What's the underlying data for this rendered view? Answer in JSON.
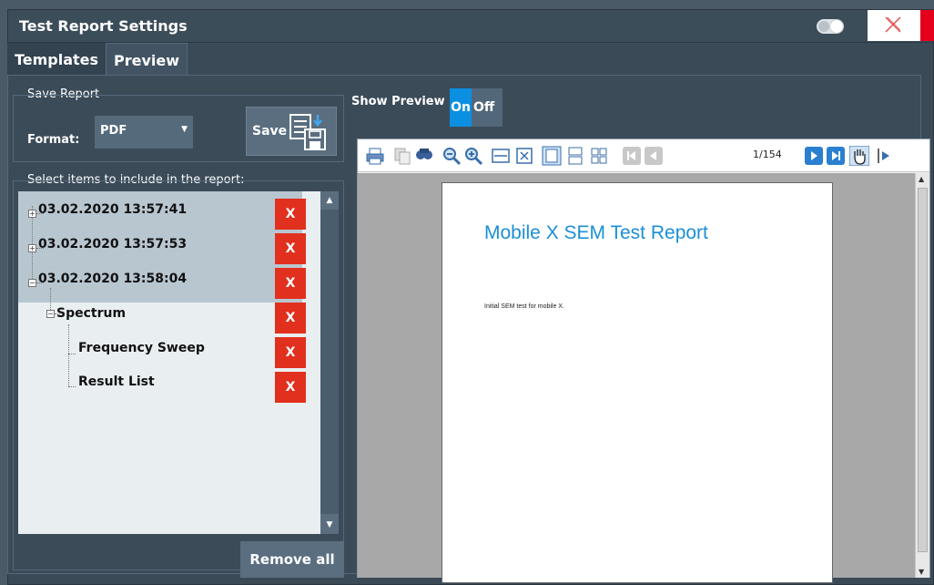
{
  "window": {
    "title": "Test Report Settings"
  },
  "tabs": [
    {
      "label": "Templates"
    },
    {
      "label": "Preview"
    }
  ],
  "save_report": {
    "group_label": "Save Report",
    "format_label": "Format:",
    "format_value": "PDF",
    "save_label": "Save"
  },
  "items": {
    "label": "Select items to include in the report:",
    "tree": [
      {
        "label": "03.02.2020 13:57:41",
        "remove": "X",
        "expander": "+"
      },
      {
        "label": "03.02.2020 13:57:53",
        "remove": "X",
        "expander": "+"
      },
      {
        "label": "03.02.2020 13:58:04",
        "remove": "X",
        "expander": "−"
      },
      {
        "label": "Spectrum",
        "remove": "X",
        "expander": "−"
      },
      {
        "label": "Frequency Sweep",
        "remove": "X"
      },
      {
        "label": "Result List",
        "remove": "X"
      }
    ],
    "remove_all": "Remove all"
  },
  "preview": {
    "label": "Show Preview",
    "on": "On",
    "off": "Off",
    "page_indicator": "1/154",
    "report_title": "Mobile X SEM Test Report",
    "report_description": "Initial SEM test for mobile X."
  },
  "colors": {
    "accent": "#0b8fe0",
    "remove": "#e1301d",
    "report_title": "#1a8fd8"
  }
}
